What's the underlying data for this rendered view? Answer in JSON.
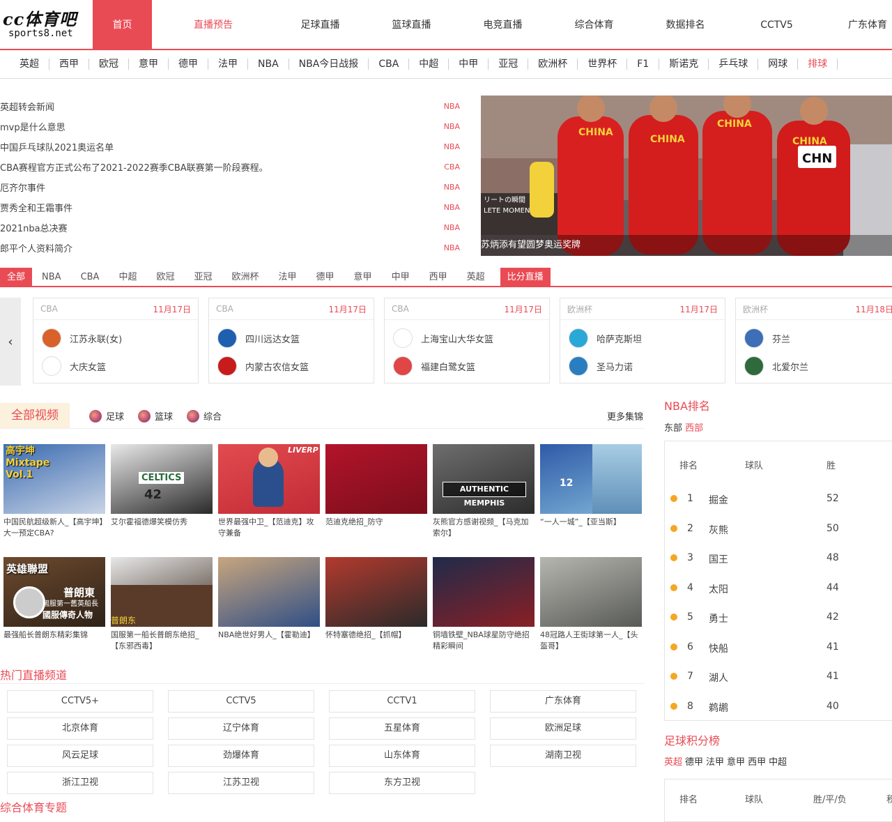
{
  "logo": {
    "line1": "cc体育吧",
    "line2": "sports8.net"
  },
  "nav": [
    {
      "label": "首页",
      "state": "active"
    },
    {
      "label": "直播预告",
      "state": "red"
    },
    {
      "label": "足球直播",
      "state": ""
    },
    {
      "label": "篮球直播",
      "state": ""
    },
    {
      "label": "电竞直播",
      "state": ""
    },
    {
      "label": "综合体育",
      "state": ""
    },
    {
      "label": "数据排名",
      "state": ""
    },
    {
      "label": "CCTV5",
      "state": ""
    },
    {
      "label": "广东体育",
      "state": ""
    }
  ],
  "subnav": [
    "英超",
    "西甲",
    "欧冠",
    "意甲",
    "德甲",
    "法甲",
    "NBA",
    "NBA今日战报",
    "CBA",
    "中超",
    "中甲",
    "亚冠",
    "欧洲杯",
    "世界杯",
    "F1",
    "斯诺克",
    "乒乓球",
    "网球",
    "排球"
  ],
  "news": [
    {
      "title": "英超转会新闻",
      "tag": "NBA"
    },
    {
      "title": "mvp是什么意思",
      "tag": "NBA"
    },
    {
      "title": "中国乒乓球队2021奥运名单",
      "tag": "NBA"
    },
    {
      "title": "CBA赛程官方正式公布了2021-2022赛季CBA联赛第一阶段赛程。",
      "tag": "CBA"
    },
    {
      "title": "厄齐尔事件",
      "tag": "NBA"
    },
    {
      "title": "贾秀全和王霜事件",
      "tag": "NBA"
    },
    {
      "title": "2021nba总决赛",
      "tag": "NBA"
    },
    {
      "title": "郎平个人资料简介",
      "tag": "NBA"
    }
  ],
  "banner": {
    "caption": "苏炳添有望圆梦奥运奖牌",
    "jersey": "CHINA",
    "bib": "CHN",
    "sign1": "リートの瞬間",
    "sign2": "LETE MOMENT"
  },
  "league_tabs": [
    "全部",
    "NBA",
    "CBA",
    "中超",
    "欧冠",
    "亚冠",
    "欧洲杯",
    "法甲",
    "德甲",
    "意甲",
    "中甲",
    "西甲",
    "英超",
    "比分直播"
  ],
  "matches": [
    {
      "league": "CBA",
      "date": "11月17日",
      "home": "江苏永联(女)",
      "away": "大庆女篮",
      "c1": "#d9622b",
      "c2": "#ffffff"
    },
    {
      "league": "CBA",
      "date": "11月17日",
      "home": "四川远达女篮",
      "away": "内蒙古农信女篮",
      "c1": "#1f5fb0",
      "c2": "#c81c1c"
    },
    {
      "league": "CBA",
      "date": "11月17日",
      "home": "上海宝山大华女篮",
      "away": "福建白鹭女篮",
      "c1": "#ffffff",
      "c2": "#e04646"
    },
    {
      "league": "欧洲杯",
      "date": "11月17日",
      "home": "哈萨克斯坦",
      "away": "圣马力诺",
      "c1": "#2aa8d8",
      "c2": "#2a7ec0"
    },
    {
      "league": "欧洲杯",
      "date": "11月18日",
      "home": "芬兰",
      "away": "北爱尔兰",
      "c1": "#3d6fb8",
      "c2": "#2f6a3c"
    }
  ],
  "video": {
    "all_label": "全部视频",
    "cats": [
      "足球",
      "篮球",
      "综合"
    ],
    "more": "更多集锦",
    "thumb_text": {
      "t1": "高宇坤",
      "t2": "Mixtape",
      "t3": "Vol.1",
      "t4": "AUTHENTIC MEMPHIS",
      "t5": "英雄聯盟",
      "t6": "普朗東",
      "t7": "國服第一舊英船長",
      "t8": "國服傳奇人物",
      "t9": "普朗东",
      "t10": "CELTICS",
      "t11": "42",
      "t12": "12",
      "t13": "LIVERP"
    },
    "items": [
      {
        "caption": "中国民航超级新人_【高宇坤】大一预定CBA?",
        "c1": "#3a6bb0",
        "c2": "#c9d4e6"
      },
      {
        "caption": "艾尔霍福德爆笑模仿秀",
        "c1": "#e9e9e9",
        "c2": "#2a2a2a"
      },
      {
        "caption": "世界最强中卫_【范迪克】攻守兼备",
        "c1": "#e24b4f",
        "c2": "#c22b35"
      },
      {
        "caption": "范迪克绝招_防守",
        "c1": "#b3142a",
        "c2": "#7a0e1c"
      },
      {
        "caption": "灰熊官方感谢视频_【马克加索尔】",
        "c1": "#6e6e6e",
        "c2": "#2c2c2c"
      },
      {
        "caption": "“一人一城”_【亚当斯】",
        "c1": "#2f5aa8",
        "c2": "#7fb6d8"
      },
      {
        "caption": "最强船长普朗东精彩集锦",
        "c1": "#6d4a2e",
        "c2": "#2e2218"
      },
      {
        "caption": "国服第一船长普朗东绝招_【东邪西毒】",
        "c1": "#e8e8e8",
        "c2": "#3b2a1f"
      },
      {
        "caption": "NBA绝世好男人_【霍勒迪】",
        "c1": "#c8a57e",
        "c2": "#2f4f86"
      },
      {
        "caption": "怀特塞德绝招_【抓帽】",
        "c1": "#b33a2e",
        "c2": "#2a2a2a"
      },
      {
        "caption": "铜墙铁壁_NBA球星防守绝招精彩瞬间",
        "c1": "#1f2b4a",
        "c2": "#8a1f25"
      },
      {
        "caption": "48冠路人王街球第一人_【头盔哥】",
        "c1": "#b6b6b0",
        "c2": "#585a55"
      }
    ]
  },
  "hot": {
    "title": "热门直播频道",
    "channels": [
      "CCTV5+",
      "CCTV5",
      "CCTV1",
      "广东体育",
      "北京体育",
      "辽宁体育",
      "五星体育",
      "欧洲足球",
      "风云足球",
      "劲爆体育",
      "山东体育",
      "湖南卫视",
      "浙江卫视",
      "江苏卫视",
      "东方卫视"
    ]
  },
  "topic": "综合体育专题",
  "nba_rank": {
    "title": "NBA排名",
    "east": "东部",
    "west": "西部",
    "head": {
      "rank": "排名",
      "team": "球队",
      "win": "胜"
    },
    "rows": [
      {
        "rank": "1",
        "team": "掘金",
        "win": "52"
      },
      {
        "rank": "2",
        "team": "灰熊",
        "win": "50"
      },
      {
        "rank": "3",
        "team": "国王",
        "win": "48"
      },
      {
        "rank": "4",
        "team": "太阳",
        "win": "44"
      },
      {
        "rank": "5",
        "team": "勇士",
        "win": "42"
      },
      {
        "rank": "6",
        "team": "快船",
        "win": "41"
      },
      {
        "rank": "7",
        "team": "湖人",
        "win": "41"
      },
      {
        "rank": "8",
        "team": "鹈鹕",
        "win": "40"
      }
    ]
  },
  "soccer_rank": {
    "title": "足球积分榜",
    "leagues": [
      "英超",
      "德甲",
      "法甲",
      "意甲",
      "西甲",
      "中超"
    ],
    "head": {
      "rank": "排名",
      "team": "球队",
      "record": "胜/平/负",
      "extra": "积"
    }
  },
  "colors": {
    "accent": "#e94b55",
    "rank_dot": "#f5a623"
  }
}
